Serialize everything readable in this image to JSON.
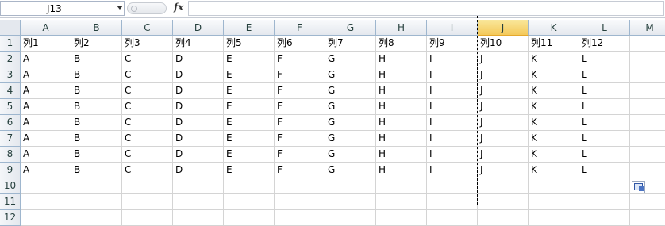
{
  "formula_bar": {
    "name_box_value": "J13",
    "fx_label": "fx",
    "formula_value": ""
  },
  "columns": [
    "A",
    "B",
    "C",
    "D",
    "E",
    "F",
    "G",
    "H",
    "I",
    "J",
    "K",
    "L",
    "M"
  ],
  "selected_column": "J",
  "rows": [
    {
      "num": "1",
      "cells": [
        "列1",
        "列2",
        "列3",
        "列4",
        "列5",
        "列6",
        "列7",
        "列8",
        "列9",
        "列10",
        "列11",
        "列12",
        ""
      ]
    },
    {
      "num": "2",
      "cells": [
        "A",
        "B",
        "C",
        "D",
        "E",
        "F",
        "G",
        "H",
        "I",
        "J",
        "K",
        "L",
        ""
      ]
    },
    {
      "num": "3",
      "cells": [
        "A",
        "B",
        "C",
        "D",
        "E",
        "F",
        "G",
        "H",
        "I",
        "J",
        "K",
        "L",
        ""
      ]
    },
    {
      "num": "4",
      "cells": [
        "A",
        "B",
        "C",
        "D",
        "E",
        "F",
        "G",
        "H",
        "I",
        "J",
        "K",
        "L",
        ""
      ]
    },
    {
      "num": "5",
      "cells": [
        "A",
        "B",
        "C",
        "D",
        "E",
        "F",
        "G",
        "H",
        "I",
        "J",
        "K",
        "L",
        ""
      ]
    },
    {
      "num": "6",
      "cells": [
        "A",
        "B",
        "C",
        "D",
        "E",
        "F",
        "G",
        "H",
        "I",
        "J",
        "K",
        "L",
        ""
      ]
    },
    {
      "num": "7",
      "cells": [
        "A",
        "B",
        "C",
        "D",
        "E",
        "F",
        "G",
        "H",
        "I",
        "J",
        "K",
        "L",
        ""
      ]
    },
    {
      "num": "8",
      "cells": [
        "A",
        "B",
        "C",
        "D",
        "E",
        "F",
        "G",
        "H",
        "I",
        "J",
        "K",
        "L",
        ""
      ]
    },
    {
      "num": "9",
      "cells": [
        "A",
        "B",
        "C",
        "D",
        "E",
        "F",
        "G",
        "H",
        "I",
        "J",
        "K",
        "L",
        ""
      ]
    },
    {
      "num": "10",
      "cells": [
        "",
        "",
        "",
        "",
        "",
        "",
        "",
        "",
        "",
        "",
        "",
        "",
        ""
      ]
    },
    {
      "num": "11",
      "cells": [
        "",
        "",
        "",
        "",
        "",
        "",
        "",
        "",
        "",
        "",
        "",
        "",
        ""
      ]
    },
    {
      "num": "12",
      "cells": [
        "",
        "",
        "",
        "",
        "",
        "",
        "",
        "",
        "",
        "",
        "",
        "",
        ""
      ]
    }
  ],
  "icons": {
    "name_box_dropdown": "chevron-down-icon",
    "paste_options": "paste-options-icon"
  }
}
